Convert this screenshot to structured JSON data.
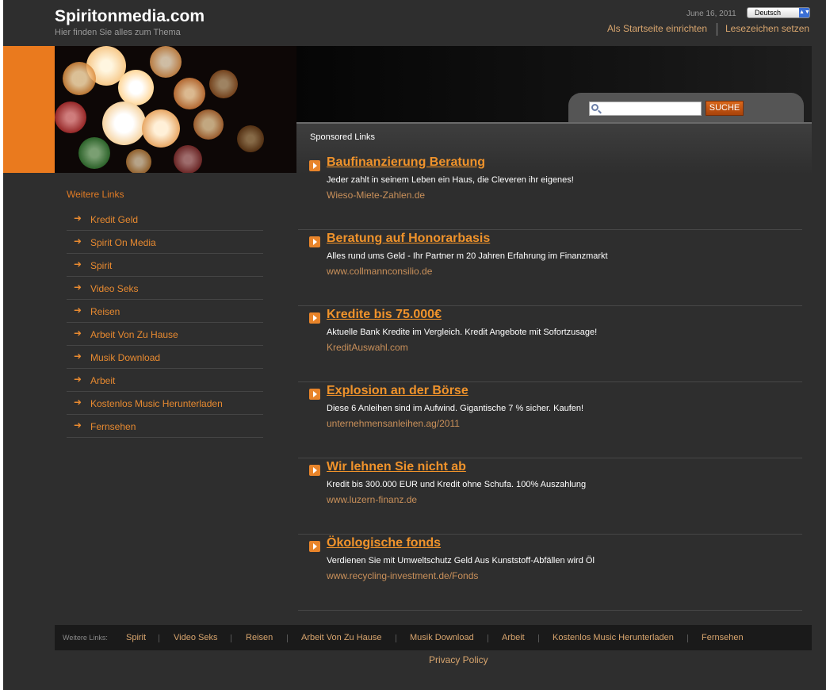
{
  "header": {
    "site_title": "Spiritonmedia.com",
    "tagline": "Hier finden Sie alles zum Thema",
    "date": "June 16, 2011",
    "language_selected": "Deutsch",
    "links": [
      "Als Startseite einrichten",
      "Lesezeichen setzen"
    ]
  },
  "search": {
    "button_label": "SUCHE",
    "value": ""
  },
  "sponsored": {
    "label": "Sponsored Links",
    "ads": [
      {
        "title": "Baufinanzierung Beratung",
        "desc": "Jeder zahlt in seinem Leben ein Haus, die Cleveren ihr eigenes!",
        "url": "Wieso-Miete-Zahlen.de"
      },
      {
        "title": "Beratung auf Honorarbasis",
        "desc": "Alles rund ums Geld - Ihr Partner m 20 Jahren Erfahrung im Finanzmarkt",
        "url": "www.collmannconsilio.de"
      },
      {
        "title": "Kredite bis 75.000€",
        "desc": "Aktuelle Bank Kredite im Vergleich. Kredit Angebote mit Sofortzusage!",
        "url": "KreditAuswahl.com"
      },
      {
        "title": "Explosion an der Börse",
        "desc": "Diese 6 Anleihen sind im Aufwind. Gigantische 7 % sicher. Kaufen!",
        "url": "unternehmensanleihen.ag/2011"
      },
      {
        "title": "Wir lehnen Sie nicht ab",
        "desc": "Kredit bis 300.000 EUR und Kredit ohne Schufa. 100% Auszahlung",
        "url": "www.luzern-finanz.de"
      },
      {
        "title": "Ökologische fonds",
        "desc": "Verdienen Sie mit Umweltschutz Geld Aus Kunststoff-Abfällen wird Öl",
        "url": "www.recycling-investment.de/Fonds"
      }
    ]
  },
  "sidebar": {
    "title": "Weitere Links",
    "items": [
      "Kredit Geld",
      "Spirit On Media",
      "Spirit",
      "Video Seks",
      "Reisen",
      "Arbeit Von Zu Hause",
      "Musik Download",
      "Arbeit",
      "Kostenlos Music Herunterladen",
      "Fernsehen"
    ]
  },
  "footer": {
    "label": "Weitere Links:",
    "links": [
      "Spirit",
      "Video Seks",
      "Reisen",
      "Arbeit Von Zu Hause",
      "Musik Download",
      "Arbeit",
      "Kostenlos Music Herunterladen",
      "Fernsehen"
    ],
    "privacy": "Privacy Policy"
  },
  "colors": {
    "accent": "#e88a30",
    "background": "#2e2e2e",
    "orange_block": "#ea7a1e"
  }
}
